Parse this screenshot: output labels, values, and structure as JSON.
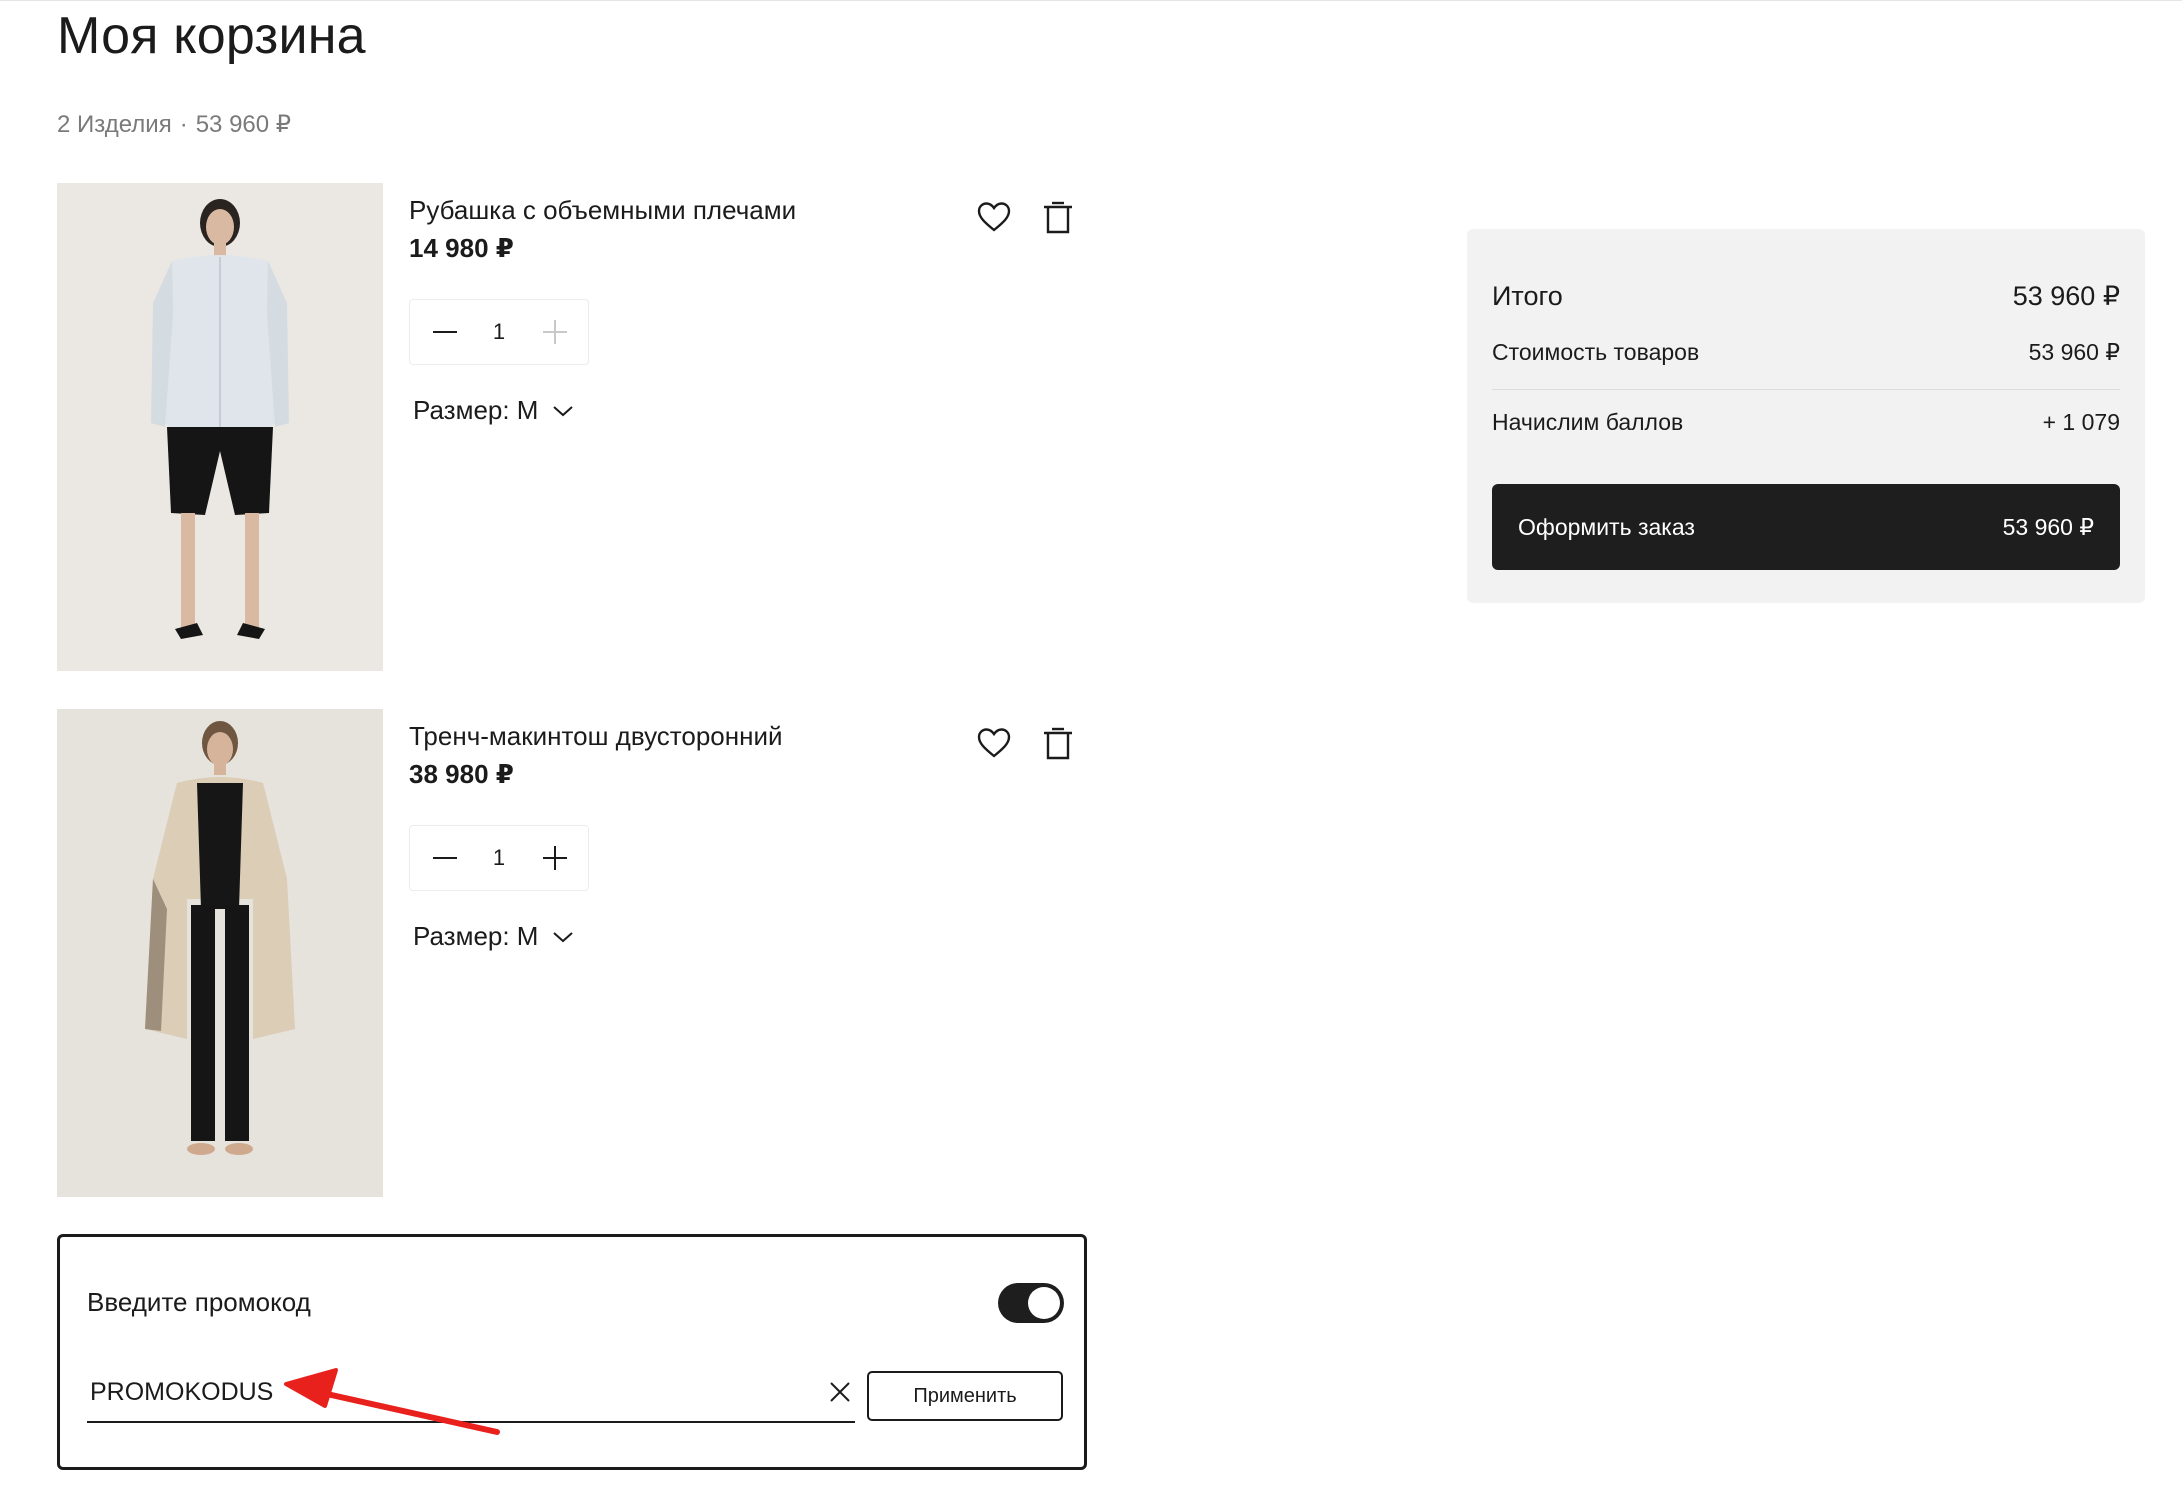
{
  "page": {
    "title": "Моя корзина",
    "items_count_label": "2 Изделия",
    "separator": "·",
    "items_total": "53 960 ₽"
  },
  "cart_items": [
    {
      "name": "Рубашка с объемными плечами",
      "price": "14 980 ₽",
      "quantity": "1",
      "size_label": "Размер: M",
      "increment_enabled": false,
      "photo_icon": "model-in-white-shirt-and-black-shorts"
    },
    {
      "name": "Тренч-макинтош двусторонний",
      "price": "38 980 ₽",
      "quantity": "1",
      "size_label": "Размер: M",
      "increment_enabled": true,
      "photo_icon": "model-in-beige-trench-coat"
    }
  ],
  "summary": {
    "total_label": "Итого",
    "total_value": "53 960 ₽",
    "goods_label": "Стоимость товаров",
    "goods_value": "53 960 ₽",
    "points_label": "Начислим баллов",
    "points_value": "+ 1 079",
    "checkout_label": "Оформить заказ",
    "checkout_value": "53 960 ₽"
  },
  "promo": {
    "title": "Введите промокод",
    "toggle_on": true,
    "input_value": "PROMOKODUS",
    "apply_label": "Применить"
  },
  "colors": {
    "accent_dark": "#1e1e1e",
    "panel_bg": "#f2f2f3",
    "muted_text": "#7a7a7a",
    "annotation_arrow": "#e8211d"
  }
}
